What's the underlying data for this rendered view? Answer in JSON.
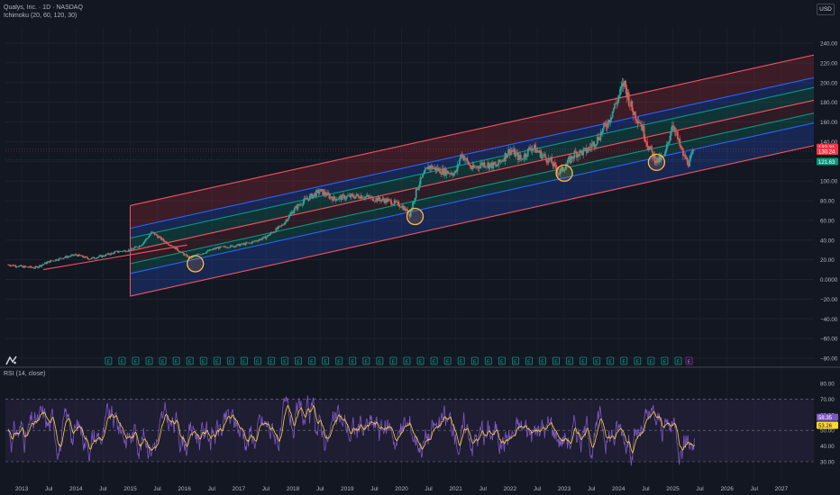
{
  "header": {
    "symbol": "Qualys, Inc. · 1D · NASDAQ",
    "indicator": "Ichimoku (20, 60, 120, 30)",
    "currency": "USD",
    "rsi_label": "RSI (14, close)"
  },
  "colors": {
    "background": "#131722",
    "channel_red": "#f7525f",
    "channel_blue": "#2962ff",
    "channel_teal": "#089981",
    "candle_up": "#26a69a",
    "candle_down": "#ef5350",
    "rsi_line": "#7e57c2",
    "rsi_ma": "#fdd835",
    "circle_marker": "#ffb74d"
  },
  "icons": {
    "logo": "tradingview-logo-icon",
    "earnings": "earnings-flag-icon"
  },
  "chart_data": [
    {
      "type": "candlestick",
      "title": "Qualys, Inc. · 1D · NASDAQ",
      "ylim": [
        -85,
        240
      ],
      "y_ticks": [
        240,
        220,
        200,
        180,
        160,
        140,
        120,
        100,
        80,
        60,
        40,
        20,
        0,
        -20,
        -40,
        -60,
        -80
      ],
      "y_tick_labels": [
        "240.00",
        "220.00",
        "200.00",
        "180.00",
        "160.00",
        "140.00",
        "120.00",
        "100.00",
        "80.00",
        "60.00",
        "40.00",
        "20.00",
        "0.0000",
        "−20.00",
        "−40.00",
        "−60.00",
        "−80.00"
      ],
      "x_ticks": [
        "2013",
        "Jul",
        "2014",
        "Jul",
        "2015",
        "Jul",
        "2016",
        "Jul",
        "2017",
        "Jul",
        "2018",
        "Jul",
        "2019",
        "Jul",
        "2020",
        "Jul",
        "2021",
        "Jul",
        "2022",
        "Jul",
        "2023",
        "Jul",
        "2024",
        "Jul",
        "2025",
        "Jul",
        "2026",
        "Jul",
        "2027"
      ],
      "x_tick_years": [
        2013.0,
        2013.5,
        2014.0,
        2014.5,
        2015.0,
        2015.5,
        2016.0,
        2016.5,
        2017.0,
        2017.5,
        2018.0,
        2018.5,
        2019.0,
        2019.5,
        2020.0,
        2020.5,
        2021.0,
        2021.5,
        2022.0,
        2022.5,
        2023.0,
        2023.5,
        2024.0,
        2024.5,
        2025.0,
        2025.5,
        2026.0,
        2026.5,
        2027.0
      ],
      "xlim": [
        2012.7,
        2027.6
      ],
      "price_series": {
        "x": [
          2012.75,
          2013.0,
          2013.25,
          2013.5,
          2013.75,
          2014.0,
          2014.25,
          2014.5,
          2014.75,
          2015.0,
          2015.2,
          2015.4,
          2015.6,
          2015.8,
          2016.0,
          2016.1,
          2016.3,
          2016.6,
          2016.9,
          2017.2,
          2017.5,
          2017.8,
          2018.0,
          2018.2,
          2018.5,
          2018.75,
          2019.0,
          2019.25,
          2019.5,
          2019.75,
          2020.0,
          2020.15,
          2020.3,
          2020.5,
          2020.75,
          2021.0,
          2021.1,
          2021.3,
          2021.5,
          2021.75,
          2022.0,
          2022.2,
          2022.4,
          2022.6,
          2022.75,
          2022.9,
          2023.0,
          2023.2,
          2023.4,
          2023.6,
          2023.8,
          2024.0,
          2024.1,
          2024.25,
          2024.4,
          2024.55,
          2024.7,
          2024.85,
          2025.0,
          2025.1,
          2025.2,
          2025.3,
          2025.4
        ],
        "y": [
          15,
          13,
          12,
          18,
          22,
          25,
          21,
          24,
          28,
          30,
          35,
          48,
          40,
          33,
          25,
          22,
          26,
          32,
          34,
          37,
          43,
          55,
          70,
          80,
          90,
          82,
          84,
          85,
          82,
          80,
          75,
          66,
          95,
          115,
          110,
          108,
          128,
          112,
          118,
          115,
          132,
          122,
          135,
          126,
          120,
          108,
          114,
          128,
          130,
          142,
          160,
          185,
          200,
          172,
          160,
          135,
          120,
          125,
          160,
          140,
          125,
          118,
          132
        ]
      },
      "last_prices": [
        "132.31",
        "130.24",
        "121.63"
      ],
      "channel_lines": {
        "x": [
          2015.0,
          2027.6
        ],
        "lines": [
          {
            "name": "upper",
            "color": "red",
            "y": [
              75,
              228
            ]
          },
          {
            "name": "blue-upper",
            "color": "blue",
            "y": [
              52,
              205
            ]
          },
          {
            "name": "teal-upper",
            "color": "teal",
            "y": [
              42,
              195
            ]
          },
          {
            "name": "mid",
            "color": "red",
            "y": [
              29,
              182
            ]
          },
          {
            "name": "teal-lower",
            "color": "teal",
            "y": [
              16,
              169
            ]
          },
          {
            "name": "blue-lower",
            "color": "blue",
            "y": [
              6,
              159
            ]
          },
          {
            "name": "lower",
            "color": "red",
            "y": [
              -17,
              136
            ]
          }
        ]
      },
      "regression_start": {
        "x": [
          2013.4,
          2016.05
        ],
        "y": [
          10,
          35
        ]
      },
      "touch_circles": [
        {
          "x": 2016.2,
          "y": 16
        },
        {
          "x": 2020.25,
          "y": 64
        },
        {
          "x": 2023.0,
          "y": 108
        },
        {
          "x": 2024.7,
          "y": 119
        }
      ],
      "earnings_markers": {
        "x": [
          2014.6,
          2014.85,
          2015.1,
          2015.35,
          2015.6,
          2015.85,
          2016.1,
          2016.35,
          2016.6,
          2016.85,
          2017.1,
          2017.35,
          2017.6,
          2017.85,
          2018.1,
          2018.35,
          2018.6,
          2018.85,
          2019.1,
          2019.35,
          2019.6,
          2019.85,
          2020.1,
          2020.35,
          2020.6,
          2020.85,
          2021.1,
          2021.35,
          2021.6,
          2021.85,
          2022.1,
          2022.35,
          2022.6,
          2022.85,
          2023.1,
          2023.35,
          2023.6,
          2023.85,
          2024.1,
          2024.35,
          2024.6,
          2024.85,
          2025.1,
          2025.3
        ],
        "label": "E"
      }
    },
    {
      "type": "line",
      "title": "RSI (14, close)",
      "ylim": [
        15,
        92
      ],
      "y_ticks": [
        80,
        70,
        60,
        50,
        40,
        30
      ],
      "y_tick_labels": [
        "80.00",
        "70.00",
        "60.00",
        "50.00",
        "40.00",
        "30.00"
      ],
      "bands": {
        "upper": 70,
        "middle": 50,
        "lower": 30
      },
      "last_values": [
        "58.35",
        "53.26"
      ],
      "series": [
        {
          "name": "RSI",
          "color": "purple"
        },
        {
          "name": "RSI MA",
          "color": "yellow"
        }
      ],
      "x_range": [
        2012.75,
        2025.4
      ]
    }
  ]
}
